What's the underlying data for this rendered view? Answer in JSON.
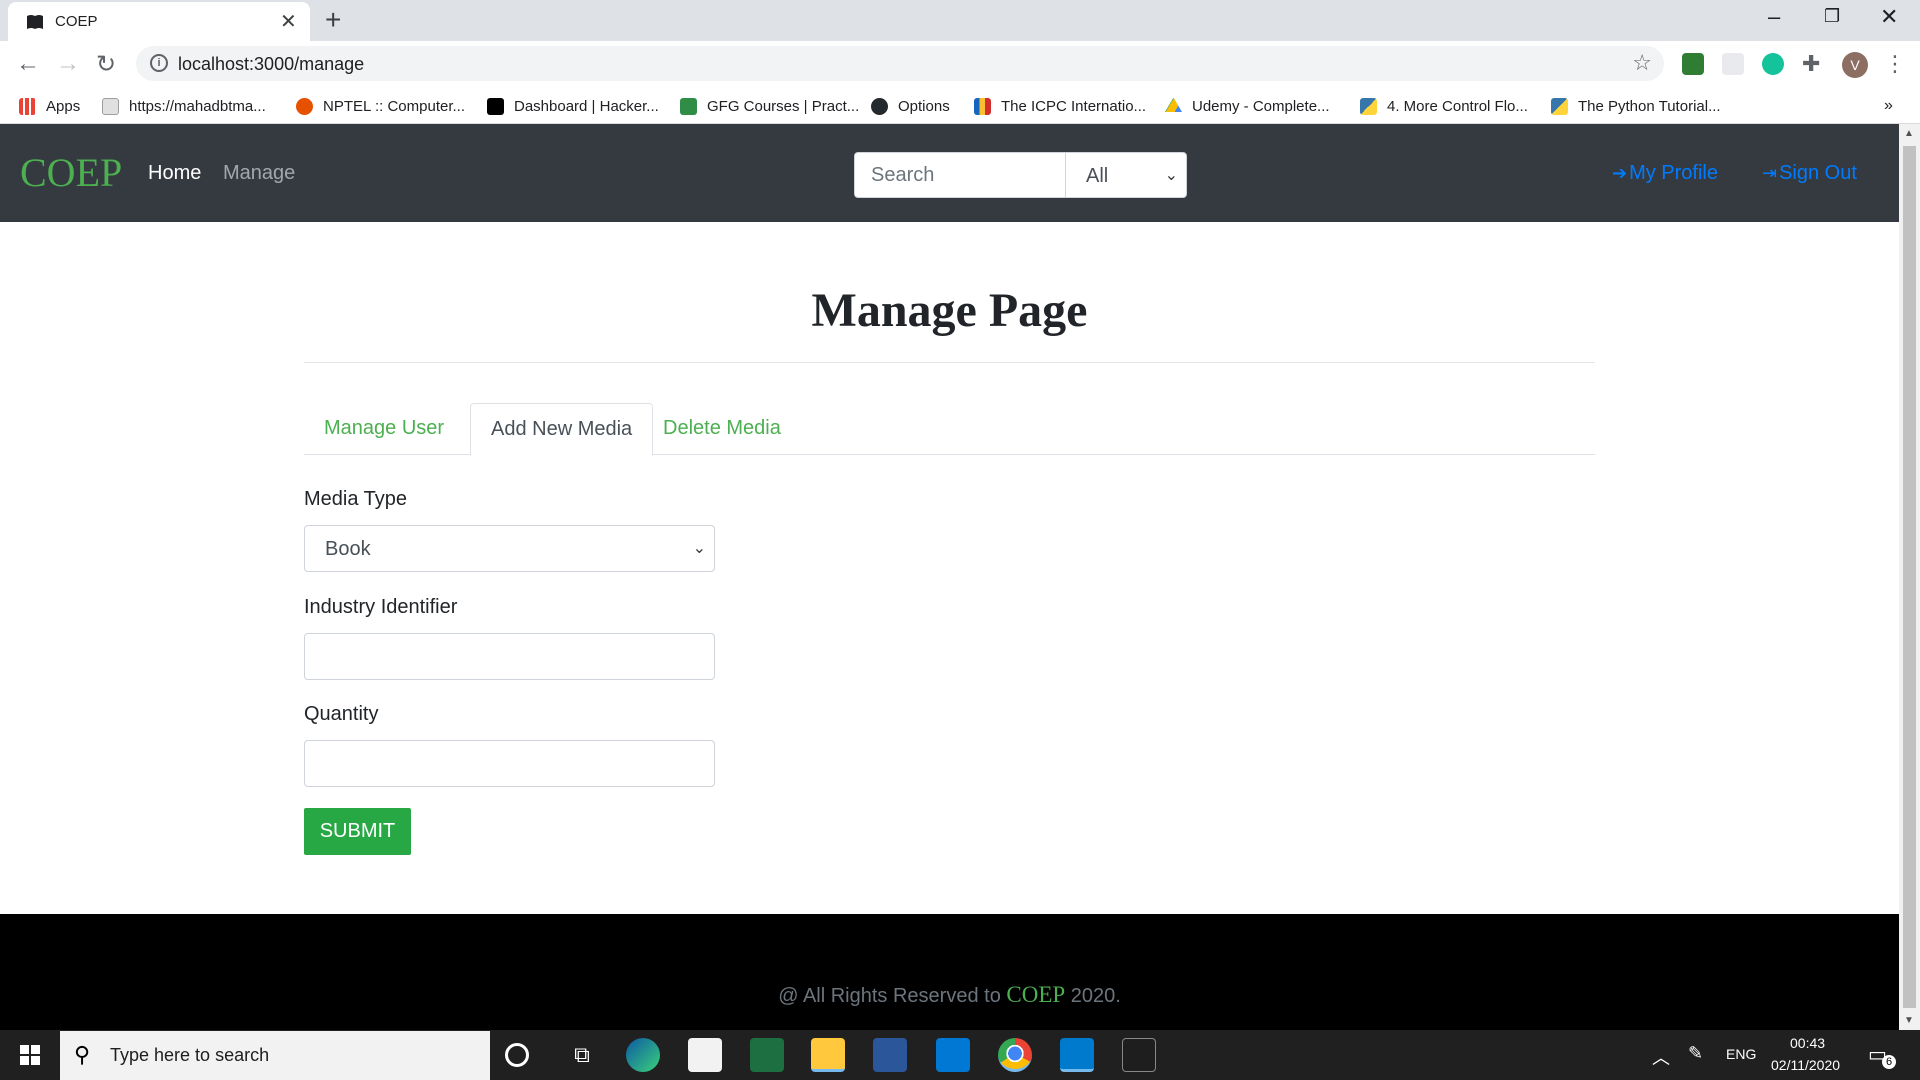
{
  "browser": {
    "tab_title": "COEP",
    "url": "localhost:3000/manage",
    "bookmarks": [
      {
        "label": "Apps",
        "color": "#ea4335"
      },
      {
        "label": "https://mahadbtma...",
        "color": "#9e9e9e"
      },
      {
        "label": "NPTEL :: Computer...",
        "color": "#e65100"
      },
      {
        "label": "Dashboard | Hacker...",
        "color": "#000000"
      },
      {
        "label": "GFG Courses | Pract...",
        "color": "#2f8d46"
      },
      {
        "label": "Options",
        "color": "#24292e"
      },
      {
        "label": "The ICPC Internatio...",
        "color": "#1565c0"
      },
      {
        "label": "Udemy - Complete...",
        "color": "#34a853"
      },
      {
        "label": "4. More Control Flo...",
        "color": "#3776ab"
      },
      {
        "label": "The Python Tutorial...",
        "color": "#3776ab"
      }
    ],
    "profile_initial": "V"
  },
  "navbar": {
    "brand": "COEP",
    "links": {
      "home": "Home",
      "manage": "Manage"
    },
    "search_placeholder": "Search",
    "search_filter": "All",
    "my_profile": "My Profile",
    "sign_out": "Sign Out"
  },
  "main": {
    "title": "Manage Page",
    "tabs": [
      {
        "label": "Manage User",
        "active": false
      },
      {
        "label": "Add New Media",
        "active": true
      },
      {
        "label": "Delete Media",
        "active": false
      }
    ],
    "form": {
      "media_type_label": "Media Type",
      "media_type_value": "Book",
      "industry_identifier_label": "Industry Identifier",
      "industry_identifier_value": "",
      "quantity_label": "Quantity",
      "quantity_value": "",
      "submit_label": "SUBMIT"
    }
  },
  "footer": {
    "prefix": "@ All Rights Reserved to ",
    "brand": "COEP",
    "suffix": " 2020."
  },
  "taskbar": {
    "search_placeholder": "Type here to search",
    "language": "ENG",
    "time": "00:43",
    "date": "02/11/2020",
    "notification_count": "6"
  },
  "colors": {
    "brand_green": "#4caf50",
    "navbar_bg": "#343a40",
    "link_blue": "#007bff",
    "submit_green": "#28a745"
  }
}
